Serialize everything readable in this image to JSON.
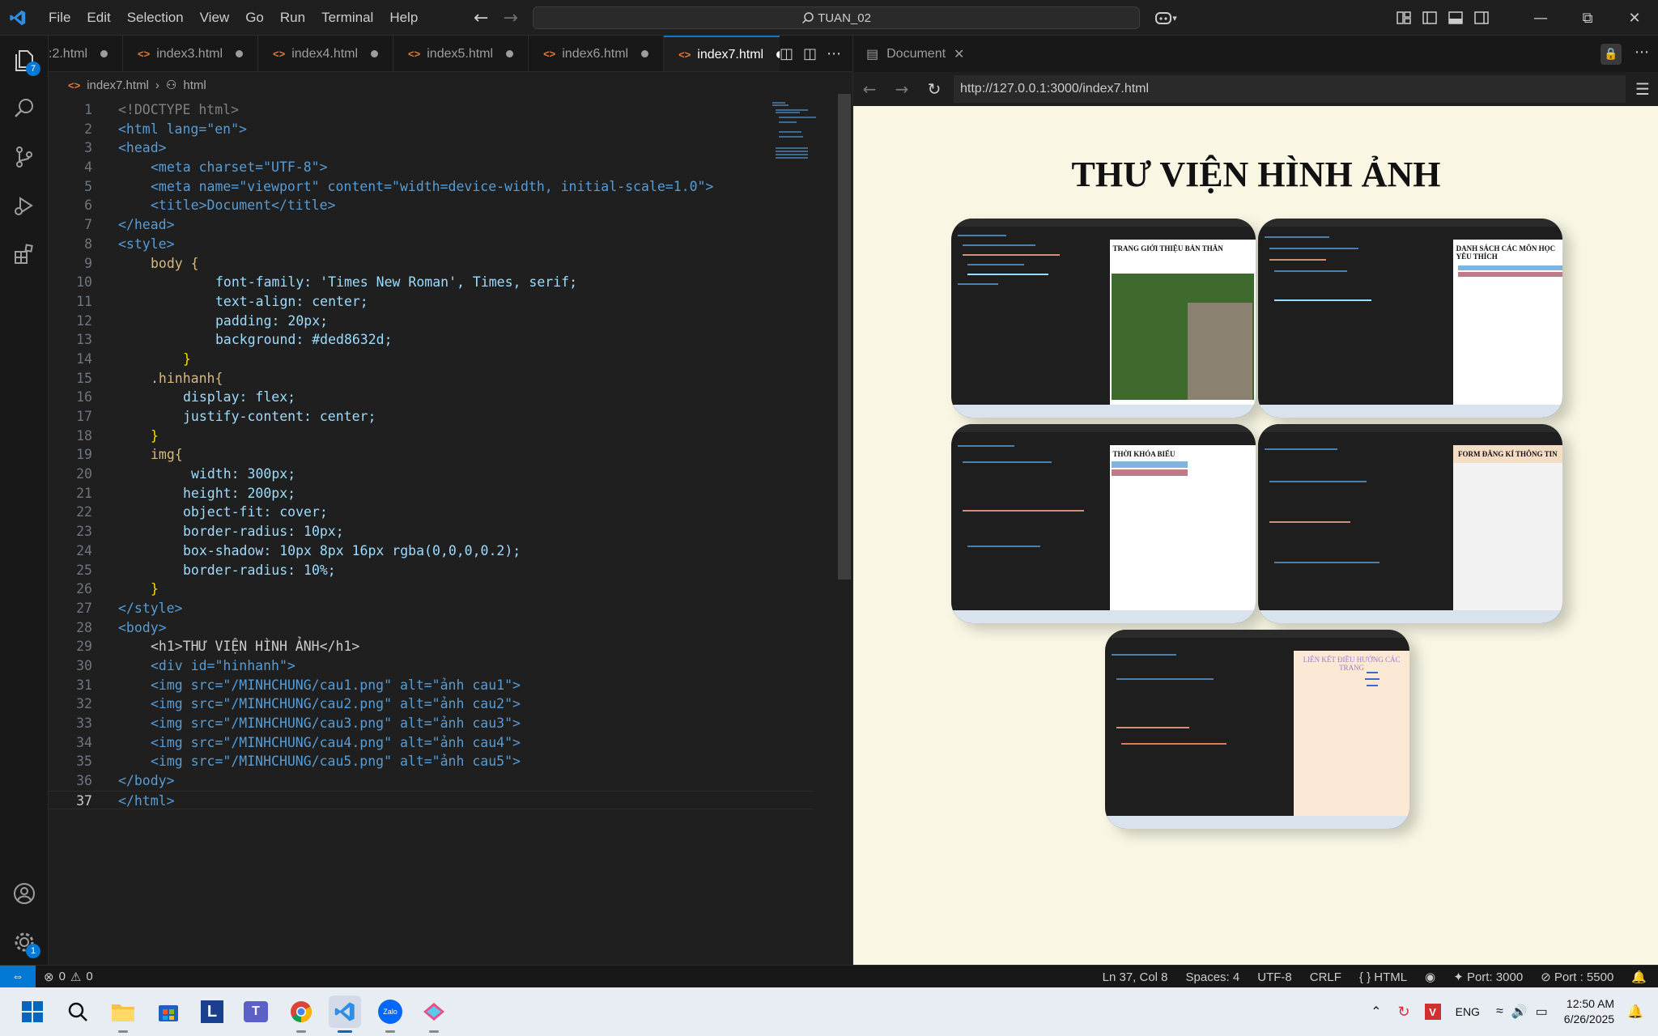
{
  "menu": [
    "File",
    "Edit",
    "Selection",
    "View",
    "Go",
    "Run",
    "Terminal",
    "Help"
  ],
  "command_center": "TUAN_02",
  "activity": {
    "explorer_badge": "7",
    "settings_badge": "1"
  },
  "tabs": [
    {
      "label": ":2.html"
    },
    {
      "label": "index3.html"
    },
    {
      "label": "index4.html"
    },
    {
      "label": "index5.html"
    },
    {
      "label": "index6.html"
    },
    {
      "label": "index7.html",
      "active": true
    }
  ],
  "breadcrumb": {
    "file": "index7.html",
    "node": "html"
  },
  "code_lines": [
    "1",
    "2",
    "3",
    "4",
    "5",
    "6",
    "7",
    "8",
    "9",
    "10",
    "11",
    "12",
    "13",
    "14",
    "15",
    "16",
    "17",
    "18",
    "19",
    "20",
    "21",
    "22",
    "23",
    "24",
    "25",
    "26",
    "27",
    "28",
    "29",
    "30",
    "31",
    "32",
    "33",
    "34",
    "35",
    "36",
    "37"
  ],
  "code": {
    "l1": "<!DOCTYPE html>",
    "l2": "<html lang=\"en\">",
    "l3": "<head>",
    "l4": "<meta charset=\"UTF-8\">",
    "l5": "<meta name=\"viewport\" content=\"width=device-width, initial-scale=1.0\">",
    "l6": "<title>Document</title>",
    "l7": "</head>",
    "l8": "<style>",
    "l9": "body {",
    "l10": "font-family: 'Times New Roman', Times, serif;",
    "l11": "text-align: center;",
    "l12": "padding: 20px;",
    "l13": "background: #ded8632d;",
    "l14": "}",
    "l15": ".hinhanh{",
    "l16": "display: flex;",
    "l17": "justify-content: center;",
    "l18": "}",
    "l19": "img{",
    "l20": "width: 300px;",
    "l21": "height: 200px;",
    "l22": "object-fit: cover;",
    "l23": "border-radius: 10px;",
    "l24": "box-shadow: 10px 8px 16px rgba(0,0,0,0.2);",
    "l25": "border-radius: 10%;",
    "l26": "}",
    "l27": "</style>",
    "l28": "<body>",
    "l29": "<h1>THƯ VIỆN HÌNH ẢNH</h1>",
    "l30": "<div id=\"hinhanh\">",
    "l31": "<img src=\"/MINHCHUNG/cau1.png\" alt=\"ảnh cau1\">",
    "l32": "<img src=\"/MINHCHUNG/cau2.png\" alt=\"ảnh cau2\">",
    "l33": "<img src=\"/MINHCHUNG/cau3.png\" alt=\"ảnh cau3\">",
    "l34": "<img src=\"/MINHCHUNG/cau4.png\" alt=\"ảnh cau4\">",
    "l35": "<img src=\"/MINHCHUNG/cau5.png\" alt=\"ảnh cau5\">",
    "l36": "</body>",
    "l37": "</html>"
  },
  "preview": {
    "tab_label": "Document",
    "url": "http://127.0.0.1:3000/index7.html",
    "heading": "THƯ VIỆN HÌNH ẢNH",
    "shot_titles": [
      "TRANG GIỚI THIỆU BẢN THÂN",
      "DANH SÁCH CÁC MÔN HỌC YÊU THÍCH",
      "THỜI KHÓA BIỂU",
      "FORM ĐĂNG KÍ THÔNG TIN",
      "LIÊN KẾT ĐIỀU HƯỚNG CÁC TRANG"
    ]
  },
  "status": {
    "errors": "0",
    "warnings": "0",
    "position": "Ln 37, Col 8",
    "spaces": "Spaces: 4",
    "encoding": "UTF-8",
    "eol": "CRLF",
    "language": "HTML",
    "port1": "Port: 3000",
    "port2": "Port : 5500"
  },
  "taskbar": {
    "lang": "ENG",
    "time": "12:50 AM",
    "date": "6/26/2025"
  },
  "colors": {
    "accent": "#0078d4",
    "preview_bg": "#f9f7e4"
  }
}
